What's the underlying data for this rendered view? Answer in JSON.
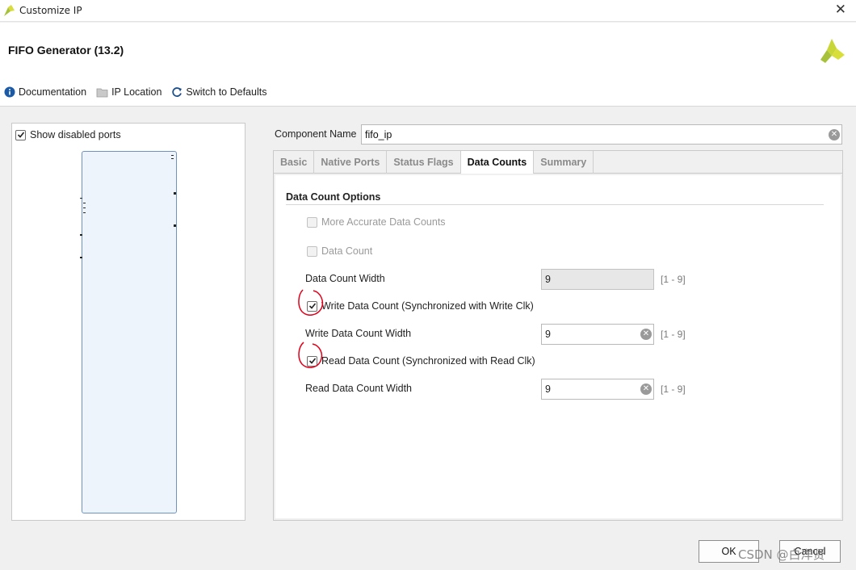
{
  "window": {
    "title": "Customize IP"
  },
  "header": {
    "ip_name": "FIFO Generator (13.2)"
  },
  "toolbar": {
    "documentation": "Documentation",
    "ip_location": "IP Location",
    "switch_defaults": "Switch to Defaults"
  },
  "left_panel": {
    "show_disabled_ports": "Show disabled ports",
    "show_disabled_checked": true
  },
  "component": {
    "label": "Component Name",
    "value": "fifo_ip"
  },
  "tabs": [
    {
      "label": "Basic",
      "active": false
    },
    {
      "label": "Native Ports",
      "active": false
    },
    {
      "label": "Status Flags",
      "active": false
    },
    {
      "label": "Data Counts",
      "active": true
    },
    {
      "label": "Summary",
      "active": false
    }
  ],
  "data_counts": {
    "section_title": "Data Count Options",
    "more_accurate": {
      "label": "More Accurate Data Counts",
      "checked": false,
      "enabled": false
    },
    "data_count": {
      "label": "Data Count",
      "checked": false,
      "enabled": false
    },
    "data_count_width": {
      "label": "Data Count Width",
      "value": "9",
      "range": "[1 - 9]",
      "enabled": false
    },
    "write_data_count": {
      "label": "Write Data Count (Synchronized with Write Clk)",
      "checked": true
    },
    "write_data_count_width": {
      "label": "Write Data Count Width",
      "value": "9",
      "range": "[1 - 9]"
    },
    "read_data_count": {
      "label": "Read Data Count (Synchronized with Read Clk)",
      "checked": true
    },
    "read_data_count_width": {
      "label": "Read Data Count Width",
      "value": "9",
      "range": "[1 - 9]"
    }
  },
  "footer": {
    "ok": "OK",
    "cancel": "Cancel"
  },
  "watermark": "CSDN @白洋贤",
  "colors": {
    "brand_green": "#a7c23a",
    "symbol_border": "#6f93bf",
    "annotation_red": "#e0001a",
    "info_blue": "#1c5aa6"
  }
}
